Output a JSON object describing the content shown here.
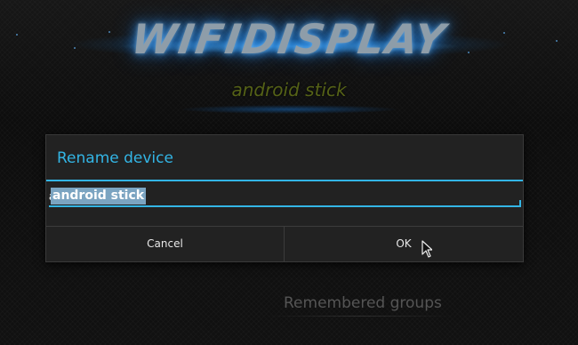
{
  "header": {
    "brand_title": "WIFIDISPLAY",
    "device_name": "android stick"
  },
  "dialog": {
    "title": "Rename device",
    "input_value": "android stick",
    "cancel_label": "Cancel",
    "ok_label": "OK"
  },
  "background": {
    "section_title": "Remembered groups"
  },
  "colors": {
    "accent": "#33b5e5",
    "title_glow": "#2f91eb",
    "device_name": "#556217",
    "dialog_background": "#222222"
  },
  "icons": {
    "pointer": "mouse-pointer-icon"
  }
}
